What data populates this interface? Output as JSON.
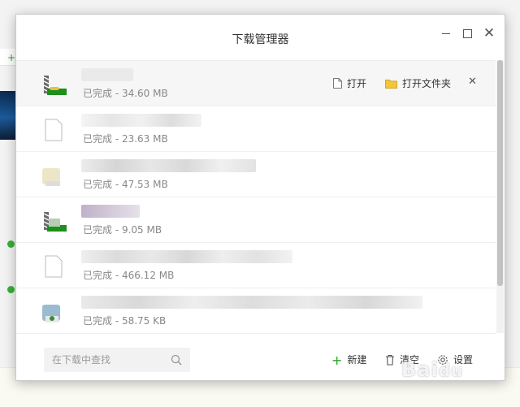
{
  "window": {
    "title": "下载管理器",
    "controls": [
      "minimize-icon",
      "maximize-icon",
      "close-icon"
    ]
  },
  "downloads": [
    {
      "icon": "archive-file-icon",
      "status": "已完成 - 34.60 MB",
      "selected": true,
      "actions": {
        "open": "打开",
        "open_folder": "打开文件夹"
      }
    },
    {
      "icon": "document-file-icon",
      "status": "已完成 - 23.63 MB"
    },
    {
      "icon": "image-file-icon",
      "status": "已完成 - 47.53 MB"
    },
    {
      "icon": "archive-file-icon",
      "status": "已完成 - 9.05 MB"
    },
    {
      "icon": "document-file-icon",
      "status": "已完成 - 466.12 MB"
    },
    {
      "icon": "installer-file-icon",
      "status": "已完成 - 58.75 KB"
    }
  ],
  "footer": {
    "search_placeholder": "在下载中查找",
    "new_label": "新建",
    "clear_label": "清空",
    "settings_label": "设置"
  },
  "colors": {
    "accent_green": "#2aa52a",
    "folder_yellow": "#f3c63a"
  }
}
